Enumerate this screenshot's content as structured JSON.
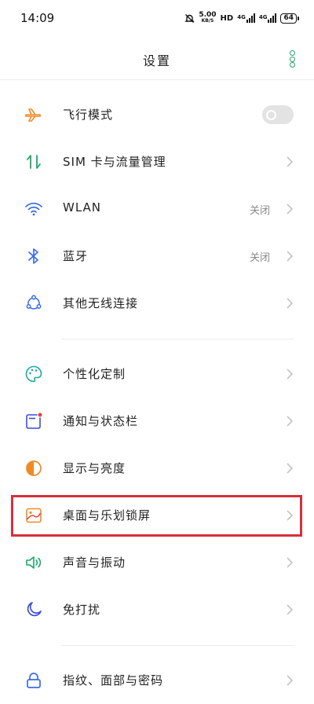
{
  "status_bar": {
    "time": "14:09",
    "speed_value": "5.00",
    "speed_unit": "KB/S",
    "hd_label": "HD",
    "net1": "4G",
    "net2": "4G",
    "battery": "64"
  },
  "header": {
    "title": "设置",
    "more_icon": "more-vertical-icon"
  },
  "colors": {
    "accent": "#1aa86b",
    "highlight_border": "#d6303a",
    "chevron": "#c4c4c4",
    "value_text": "#888888"
  },
  "settings": [
    {
      "label": "飞行模式",
      "icon": "airplane-icon",
      "icon_color": "#f08a24",
      "control": "toggle",
      "toggle_on": false
    },
    {
      "label": "SIM 卡与流量管理",
      "icon": "data-transfer-icon",
      "icon_color": "#1aa86b",
      "control": "chevron"
    },
    {
      "label": "WLAN",
      "icon": "wifi-icon",
      "icon_color": "#3a6bea",
      "control": "chevron",
      "value": "关闭"
    },
    {
      "label": "蓝牙",
      "icon": "bluetooth-icon",
      "icon_color": "#3a6bea",
      "control": "chevron",
      "value": "关闭"
    },
    {
      "label": "其他无线连接",
      "icon": "wireless-connections-icon",
      "icon_color": "#3a6bea",
      "control": "chevron"
    },
    {
      "label": "个性化定制",
      "icon": "palette-icon",
      "icon_color": "#19a8a0",
      "control": "chevron"
    },
    {
      "label": "通知与状态栏",
      "icon": "notification-icon",
      "icon_color": "#e8413c",
      "control": "chevron"
    },
    {
      "label": "显示与亮度",
      "icon": "brightness-icon",
      "icon_color": "#f08a24",
      "control": "chevron"
    },
    {
      "label": "桌面与乐划锁屏",
      "icon": "wallpaper-icon",
      "icon_color": "#f08a24",
      "control": "chevron"
    },
    {
      "label": "声音与振动",
      "icon": "speaker-vibrate-icon",
      "icon_color": "#1aa86b",
      "control": "chevron"
    },
    {
      "label": "免打扰",
      "icon": "moon-icon",
      "icon_color": "#3a4dd6",
      "control": "chevron"
    },
    {
      "label": "指纹、面部与密码",
      "icon": "lock-icon",
      "icon_color": "#3a6bea",
      "control": "chevron"
    }
  ]
}
